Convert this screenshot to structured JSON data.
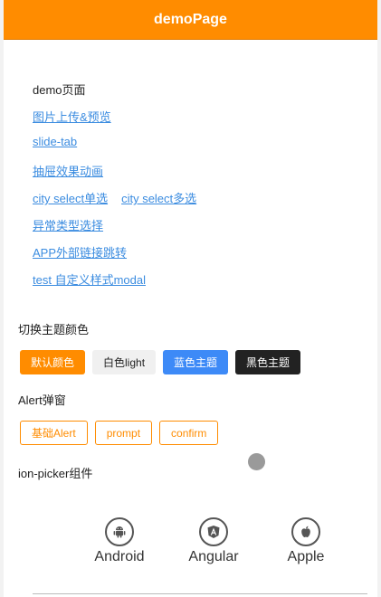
{
  "header": {
    "title": "demoPage"
  },
  "demo": {
    "title": "demo页面",
    "links": {
      "image_upload": "图片上传&预览",
      "slide_tab": "slide-tab",
      "drawer": "抽屉效果动画",
      "city_single": "city select单选",
      "city_multi": "city select多选",
      "error_types": "异常类型选择",
      "app_link": "APP外部链接跳转",
      "modal": "test 自定义样式modal"
    }
  },
  "theme": {
    "label": "切换主题颜色",
    "buttons": {
      "default": "默认颜色",
      "light": "白色light",
      "blue": "蓝色主题",
      "dark": "黑色主题"
    }
  },
  "alert": {
    "label": "Alert弹窗",
    "buttons": {
      "basic": "基础Alert",
      "prompt": "prompt",
      "confirm": "confirm"
    }
  },
  "picker": {
    "label": "ion-picker组件"
  },
  "segment": {
    "items": [
      {
        "label": "Android",
        "icon": "android-icon"
      },
      {
        "label": "Angular",
        "icon": "angular-icon"
      },
      {
        "label": "Apple",
        "icon": "apple-icon"
      }
    ]
  },
  "colors": {
    "accent": "#ff8c00",
    "link": "#3b8ce0",
    "blue_theme": "#3d8af7",
    "dark_theme": "#222222"
  }
}
